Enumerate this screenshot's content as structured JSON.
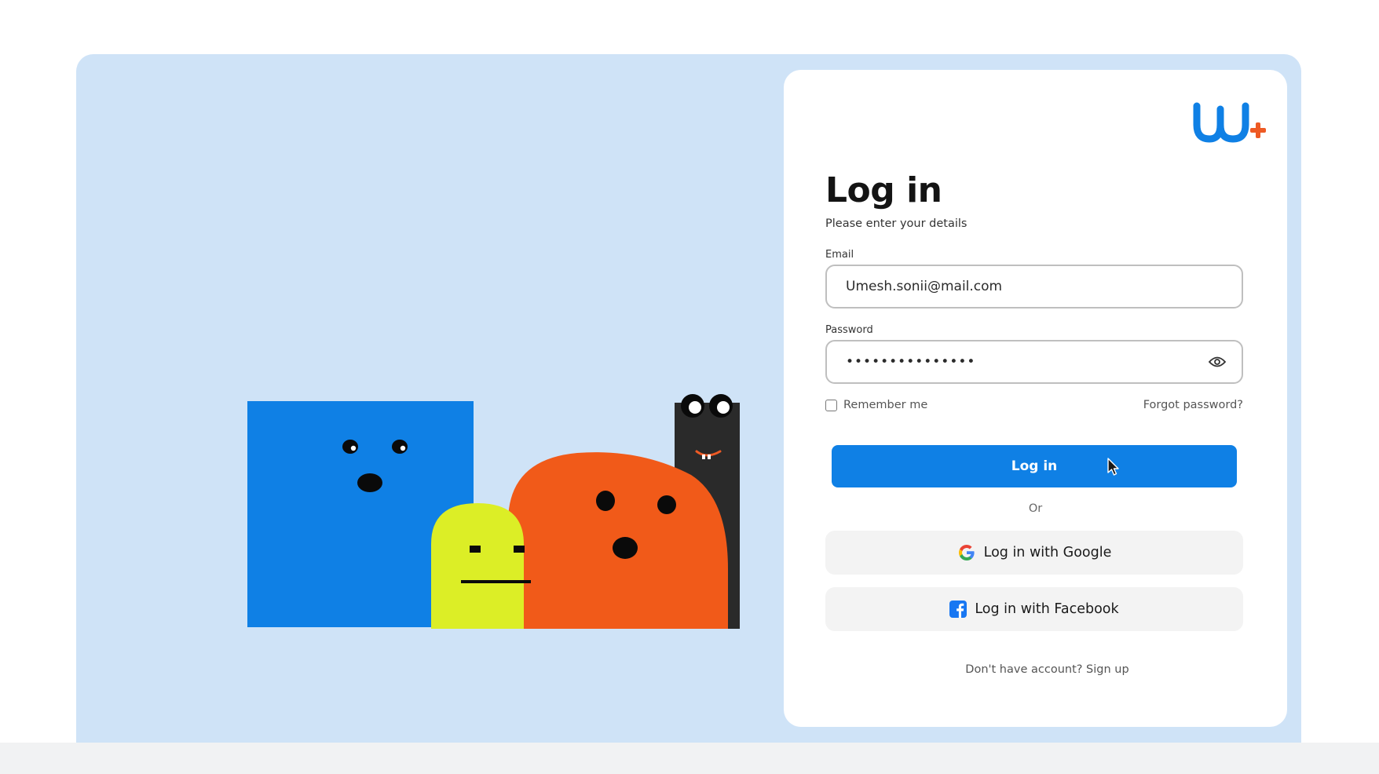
{
  "login": {
    "title": "Log in",
    "subtitle": "Please enter your details",
    "email_label": "Email",
    "email_value": "Umesh.sonii@mail.com",
    "password_label": "Password",
    "password_masked": "•••••••••••••••",
    "remember_label": "Remember me",
    "forgot_label": "Forgot password?",
    "login_button": "Log in",
    "or_text": "Or",
    "google_button": "Log in with Google",
    "facebook_button": "Log in with Facebook",
    "signup_text": "Don't have account? Sign up"
  },
  "icons": {
    "logo": "w-plus-logo",
    "password_toggle": "eye-icon",
    "google": "google-icon",
    "facebook": "facebook-icon",
    "cursor": "mouse-cursor-icon"
  },
  "colors": {
    "background_panel": "#cfe3f7",
    "primary_button": "#0f80e5",
    "logo_blue": "#0f80e5",
    "logo_orange": "#ee5a24",
    "blue_character": "#0f80e5",
    "yellow_character": "#dcee26",
    "orange_character": "#f15a19",
    "black_character": "#2a2a2a"
  }
}
